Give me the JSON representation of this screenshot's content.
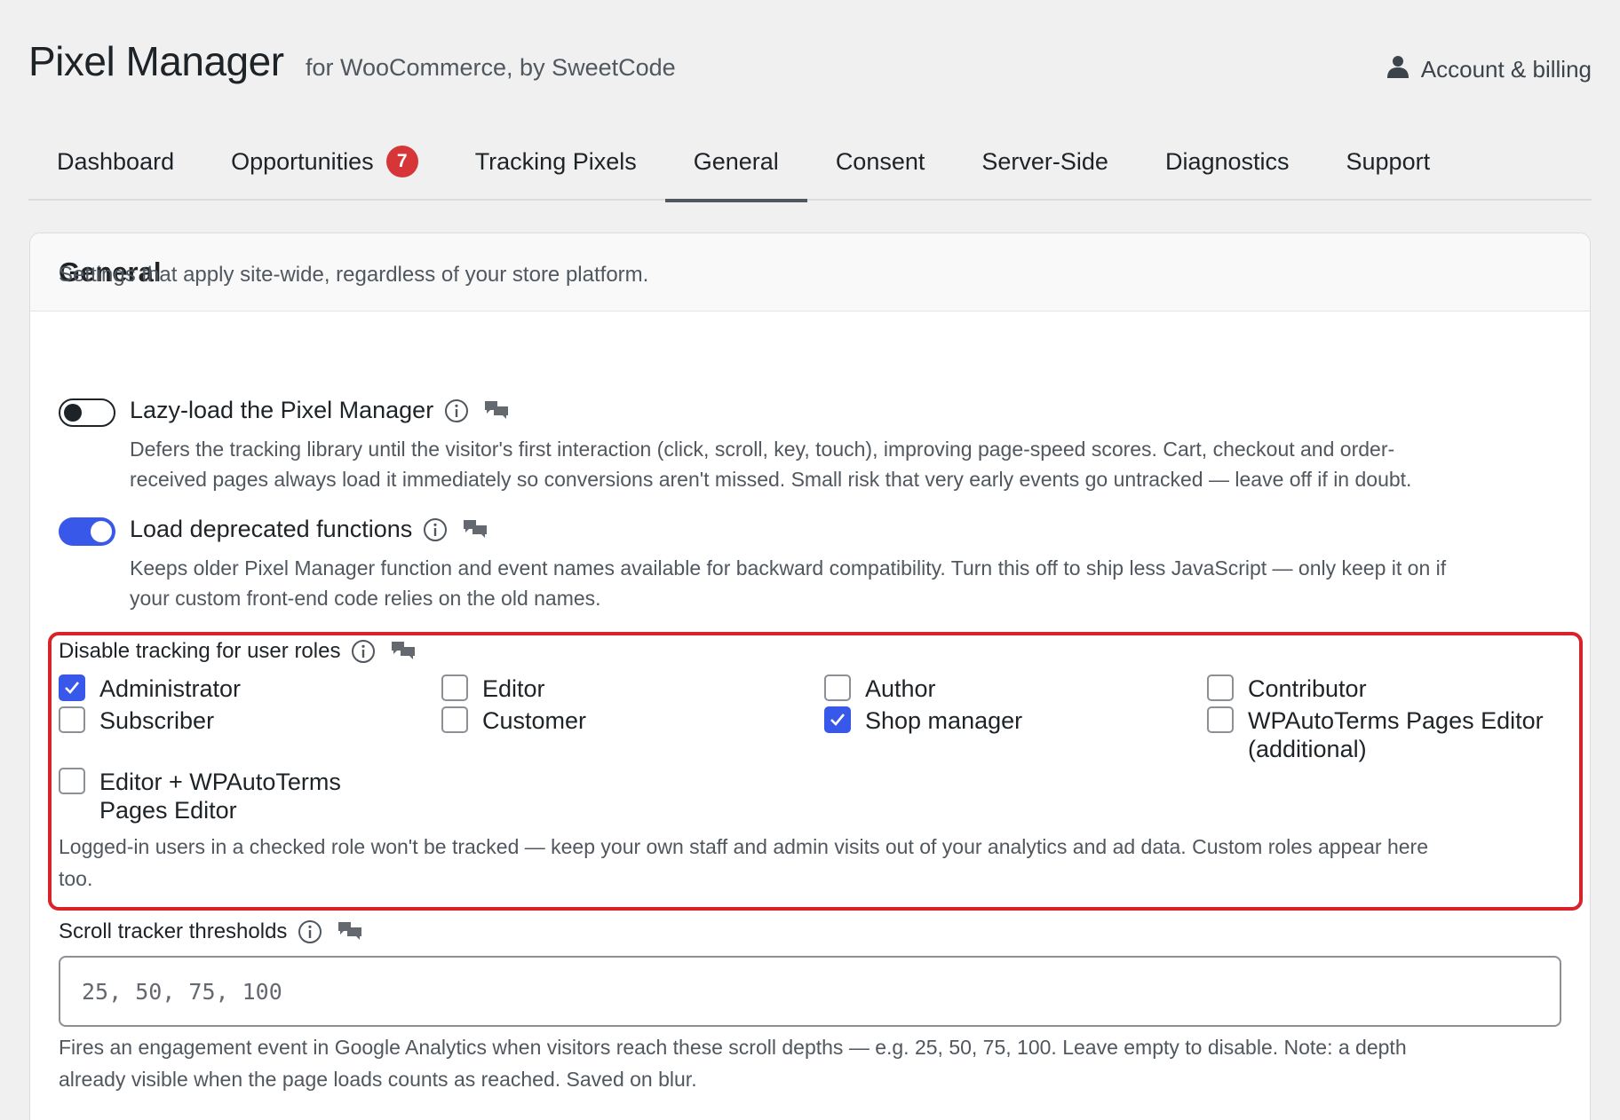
{
  "header": {
    "title": "Pixel Manager",
    "subtitle": "for WooCommerce, by SweetCode",
    "account_label": "Account & billing"
  },
  "tabs": [
    {
      "label": "Dashboard",
      "active": false
    },
    {
      "label": "Opportunities",
      "badge": "7",
      "active": false
    },
    {
      "label": "Tracking Pixels",
      "active": false
    },
    {
      "label": "General",
      "active": true
    },
    {
      "label": "Consent",
      "active": false
    },
    {
      "label": "Server-Side",
      "active": false
    },
    {
      "label": "Diagnostics",
      "active": false
    },
    {
      "label": "Support",
      "active": false
    }
  ],
  "card": {
    "title": "General",
    "intro": "Settings that apply site-wide, regardless of your store platform."
  },
  "settings": {
    "lazy_load": {
      "label": "Lazy-load the Pixel Manager",
      "enabled": false,
      "desc_line1": "Defers the tracking library until the visitor's first interaction (click, scroll, key, touch), improving page-speed scores. Cart, checkout and order-",
      "desc_line2": "received pages always load it immediately so conversions aren't missed. Small risk that very early events go untracked — leave off if in doubt."
    },
    "deprecated": {
      "label": "Load deprecated functions",
      "enabled": true,
      "desc_line1": "Keeps older Pixel Manager function and event names available for backward compatibility. Turn this off to ship less JavaScript — only keep it on if",
      "desc_line2": "your custom front-end code relies on the old names."
    }
  },
  "roles": {
    "title": "Disable tracking for user roles",
    "items": [
      {
        "label": "Administrator",
        "checked": true
      },
      {
        "label": "Editor",
        "checked": false
      },
      {
        "label": "Author",
        "checked": false
      },
      {
        "label": "Contributor",
        "checked": false
      },
      {
        "label": "Subscriber",
        "checked": false
      },
      {
        "label": "Customer",
        "checked": false
      },
      {
        "label": "Shop manager",
        "checked": true
      },
      {
        "label": "WPAutoTerms Pages Editor",
        "label2": "(additional)",
        "checked": false
      },
      {
        "label": "Editor + WPAutoTerms",
        "label2": "Pages Editor",
        "checked": false
      }
    ],
    "desc_line1": "Logged-in users in a checked role won't be tracked — keep your own staff and admin visits out of your analytics and ad data. Custom roles appear here",
    "desc_line2": "too."
  },
  "scroll": {
    "label": "Scroll tracker thresholds",
    "placeholder": "25, 50, 75, 100",
    "value": "",
    "desc_line1": "Fires an engagement event in Google Analytics when visitors reach these scroll depths — e.g. 25, 50, 75, 100. Leave empty to disable. Note: a depth",
    "desc_line2": "already visible when the page loads counts as reached. Saved on blur."
  },
  "colors": {
    "accent": "#3858e9",
    "badge": "#d63638",
    "highlight": "#d8232a"
  },
  "icons": [
    "user-icon",
    "info-icon",
    "chat-icon",
    "checkmark-icon"
  ]
}
